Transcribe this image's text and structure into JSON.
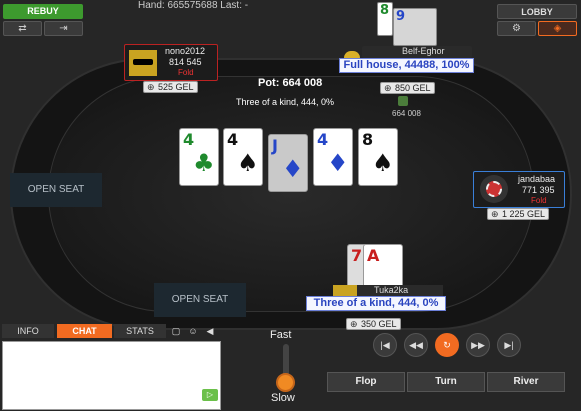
{
  "topbar": {
    "rebuy_label": "REBUY",
    "hand_info": "Hand: 665575688  Last: -",
    "lobby_label": "LOBBY",
    "left_btn1_icon": "⇄",
    "left_btn2_icon": "⇥",
    "right_btn1_icon": "⚙",
    "right_btn2_icon": "◈"
  },
  "table": {
    "pot_label": "Pot: 664 008",
    "board_desc": "Three of a kind, 444, 0%",
    "side_pot_amount": "664 008",
    "board": [
      {
        "rank": "4",
        "suit": "♣",
        "color": "green"
      },
      {
        "rank": "4",
        "suit": "♠",
        "color": "black"
      },
      {
        "rank": "J",
        "suit": "♦",
        "color": "blue"
      },
      {
        "rank": "4",
        "suit": "♦",
        "color": "blue"
      },
      {
        "rank": "8",
        "suit": "♠",
        "color": "black"
      }
    ]
  },
  "players": {
    "nono": {
      "name": "nono2012",
      "stack": "814 545",
      "status": "Fold",
      "chips": "525 GEL"
    },
    "belf": {
      "name": "Belf-Eghor",
      "hand": "Full house, 44488, 100%",
      "chips": "850 GEL",
      "cards": [
        "8",
        "9"
      ]
    },
    "janda": {
      "name": "jandabaa",
      "stack": "771 395",
      "status": "Fold",
      "chips": "1 225 GEL"
    },
    "tuka": {
      "name": "Tuka2ka",
      "hand": "Three of a kind, 444, 0%",
      "chips": "350 GEL",
      "cards": [
        "7",
        "A"
      ]
    }
  },
  "seats": {
    "left": "OPEN SEAT",
    "bottom": "OPEN SEAT"
  },
  "chat": {
    "tabs": [
      "INFO",
      "CHAT",
      "STATS"
    ],
    "send_icon": "▷"
  },
  "speed": {
    "fast_label": "Fast",
    "slow_label": "Slow"
  },
  "replay": {
    "streets": [
      "Flop",
      "Turn",
      "River"
    ]
  },
  "colors": {
    "accent_orange": "#f26b21",
    "rebuy_green": "#3d9a2e",
    "hand_blue": "#2a44c0"
  }
}
